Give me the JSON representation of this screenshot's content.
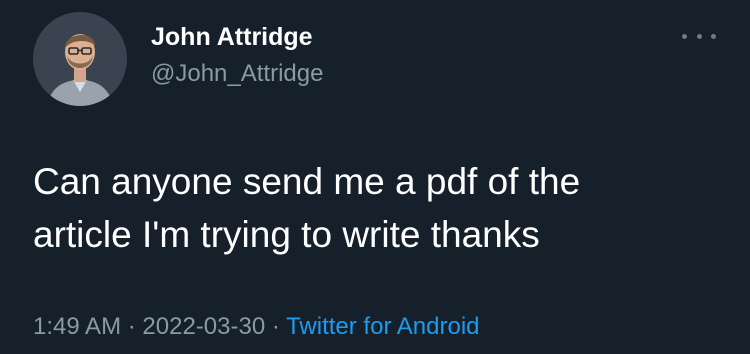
{
  "user": {
    "display_name": "John Attridge",
    "handle": "@John_Attridge",
    "avatar_icon": "profile-photo"
  },
  "menu": {
    "icon": "more-horizontal-icon"
  },
  "tweet": {
    "line1": "Can anyone send me a pdf of the",
    "line2": "article I'm trying to write thanks"
  },
  "meta": {
    "time": "1:49 AM",
    "separator": "·",
    "date": "2022-03-30",
    "source": "Twitter for Android"
  },
  "colors": {
    "background": "#15202b",
    "primary_text": "#ffffff",
    "secondary_text": "#8b98a5",
    "link": "#1d9bf0"
  }
}
